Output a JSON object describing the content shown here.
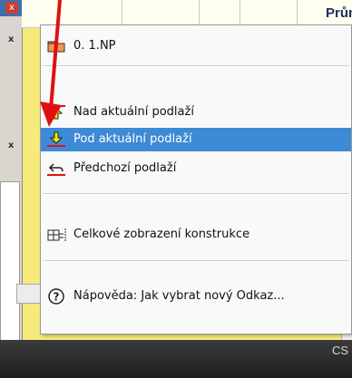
{
  "header": {
    "column_title": "Průmě"
  },
  "left_window": {
    "close_glyph": "x",
    "marker_1": "x",
    "marker_2": "x"
  },
  "menu": {
    "items": [
      {
        "icon": "folder-icon",
        "label": "0.  1.NP"
      },
      {
        "icon": "arrow-up-icon",
        "label": "Nad aktuální podlaží"
      },
      {
        "icon": "arrow-down-icon",
        "label": "Pod aktuální podlaží",
        "selected": true
      },
      {
        "icon": "back-arrow-icon",
        "label": "Předchozí podlaží"
      },
      {
        "icon": "building-structure-icon",
        "label": "Celkové zobrazení konstrukce"
      },
      {
        "icon": "help-icon",
        "label": "Nápověda: Jak vybrat nový Odkaz..."
      }
    ]
  },
  "bottom_bar": {
    "text": "CS"
  },
  "colors": {
    "highlight": "#3d8ad6",
    "annotation_arrow": "#e01010",
    "background": "#f5ea7a"
  }
}
